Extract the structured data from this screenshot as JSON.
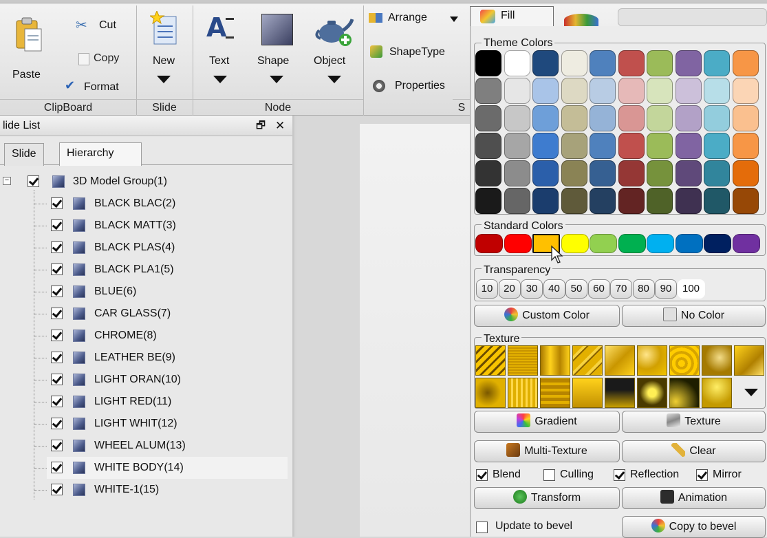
{
  "ribbon": {
    "clipboard": {
      "paste": "Paste",
      "cut": "Cut",
      "copy": "Copy",
      "format": "Format",
      "group": "ClipBoard"
    },
    "slide": {
      "new": "New",
      "group": "Slide"
    },
    "node": {
      "text": "Text",
      "shape": "Shape",
      "object": "Object",
      "group": "Node"
    },
    "arrange": {
      "arrange": "Arrange",
      "shapetype": "ShapeType",
      "properties": "Properties",
      "group_partial": "S"
    },
    "fill_tab": "Fill"
  },
  "slide_list": {
    "title": "lide List",
    "tabs": [
      "Slide",
      "Hierarchy"
    ],
    "root": "3D Model Group(1)",
    "items": [
      "BLACK BLAC(2)",
      "BLACK MATT(3)",
      "BLACK PLAS(4)",
      "BLACK PLA1(5)",
      "BLUE(6)",
      "CAR GLASS(7)",
      "CHROME(8)",
      "LEATHER BE(9)",
      "LIGHT ORAN(10)",
      "LIGHT RED(11)",
      "LIGHT WHIT(12)",
      "WHEEL ALUM(13)",
      "WHITE BODY(14)",
      "WHITE-1(15)"
    ],
    "selected_index": 12
  },
  "fill": {
    "theme_title": "Theme Colors",
    "theme_colors": [
      [
        "#000000",
        "#ffffff",
        "#1f497d",
        "#eeece1",
        "#4f81bd",
        "#c0504d",
        "#9bbb59",
        "#8064a2",
        "#4bacc6",
        "#f79646"
      ],
      [
        "#7f7f7f",
        "#e6e6e6",
        "#a9c4e8",
        "#ddd9c3",
        "#b8cce4",
        "#e6b9b8",
        "#d7e4bc",
        "#ccc0da",
        "#b7dee8",
        "#fbd5b5"
      ],
      [
        "#6b6b6b",
        "#c7c7c7",
        "#6e9fd9",
        "#c4bd97",
        "#95b3d7",
        "#d99694",
        "#c3d69b",
        "#b2a1c7",
        "#93cddd",
        "#fac08f"
      ],
      [
        "#4f4f4f",
        "#a6a6a6",
        "#3e7ccf",
        "#a7a27a",
        "#4f81bd",
        "#c0504d",
        "#9bbb59",
        "#8064a2",
        "#4bacc6",
        "#f79646"
      ],
      [
        "#333333",
        "#8c8c8c",
        "#2b5faa",
        "#8a8355",
        "#366092",
        "#953735",
        "#76923c",
        "#5f497a",
        "#31859c",
        "#e46c0a"
      ],
      [
        "#1a1a1a",
        "#666666",
        "#1b3d6d",
        "#5f5a3a",
        "#244061",
        "#632423",
        "#4f6228",
        "#3f3151",
        "#205867",
        "#974806"
      ]
    ],
    "standard_title": "Standard Colors",
    "standard_colors": [
      "#c00000",
      "#ff0000",
      "#ffc000",
      "#ffff00",
      "#92d050",
      "#00b050",
      "#00b0f0",
      "#0070c0",
      "#002060",
      "#7030a0"
    ],
    "standard_selected": 2,
    "transparency_title": "Transparency",
    "transparency": [
      "10",
      "20",
      "30",
      "40",
      "50",
      "60",
      "70",
      "80",
      "90",
      "100"
    ],
    "transparency_selected": 9,
    "custom_color": "Custom Color",
    "no_color": "No Color",
    "texture_title": "Texture",
    "gradient": "Gradient",
    "texture": "Texture",
    "multi_texture": "Multi-Texture",
    "clear": "Clear",
    "options": [
      {
        "label": "Blend",
        "checked": true
      },
      {
        "label": "Culling",
        "checked": false
      },
      {
        "label": "Reflection",
        "checked": true
      },
      {
        "label": "Mirror",
        "checked": true
      }
    ],
    "transform": "Transform",
    "animation": "Animation",
    "update_bevel": "Update to bevel",
    "copy_bevel": "Copy to bevel"
  },
  "colors": {
    "selection_accent": "#ffc000",
    "texture_gold": "#d4a000"
  }
}
